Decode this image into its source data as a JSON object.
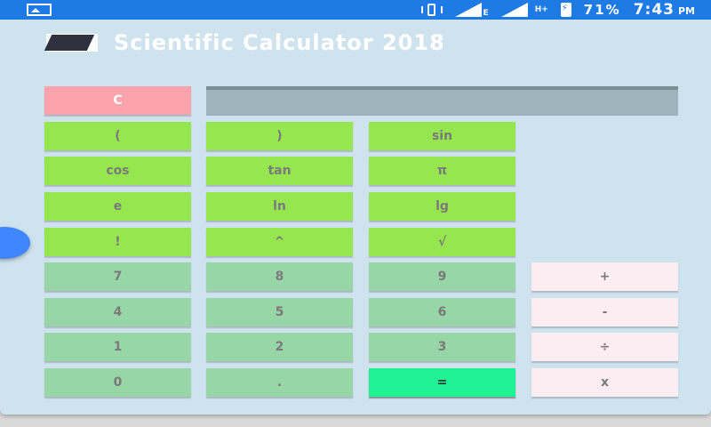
{
  "status_bar": {
    "network": "E",
    "dual_sim": "H+",
    "battery": "71%",
    "time": "7:43",
    "ampm": "PM"
  },
  "app": {
    "title": "Scientific Calculator 2018",
    "display_value": ""
  },
  "keys": {
    "clear": "C",
    "open_paren": "(",
    "close_paren": ")",
    "sin": "sin",
    "cos": "cos",
    "tan": "tan",
    "pi": "π",
    "e": "e",
    "ln": "ln",
    "lg": "lg",
    "factorial": "!",
    "power": "^",
    "sqrt": "√",
    "seven": "7",
    "eight": "8",
    "nine": "9",
    "plus": "+",
    "four": "4",
    "five": "5",
    "six": "6",
    "minus": "-",
    "one": "1",
    "two": "2",
    "three": "3",
    "divide": "÷",
    "zero": "0",
    "dot": ".",
    "equals": "=",
    "multiply": "x"
  },
  "icons": {
    "status_left": "gallery-icon",
    "vibrate": "vibrate-icon",
    "signal": "signal-icon",
    "battery": "battery-charging-icon",
    "app": "calculator-icon"
  },
  "colors": {
    "status_bar": "#1e7be6",
    "background": "#cfe3ee",
    "clear_key": "#fda3ac",
    "function_key": "#96e650",
    "number_key": "#98d6a8",
    "operator_key": "#fcedf2",
    "equals_key": "#20f294",
    "display": "#9eb4bc",
    "assist_bubble": "#3f86ff"
  }
}
